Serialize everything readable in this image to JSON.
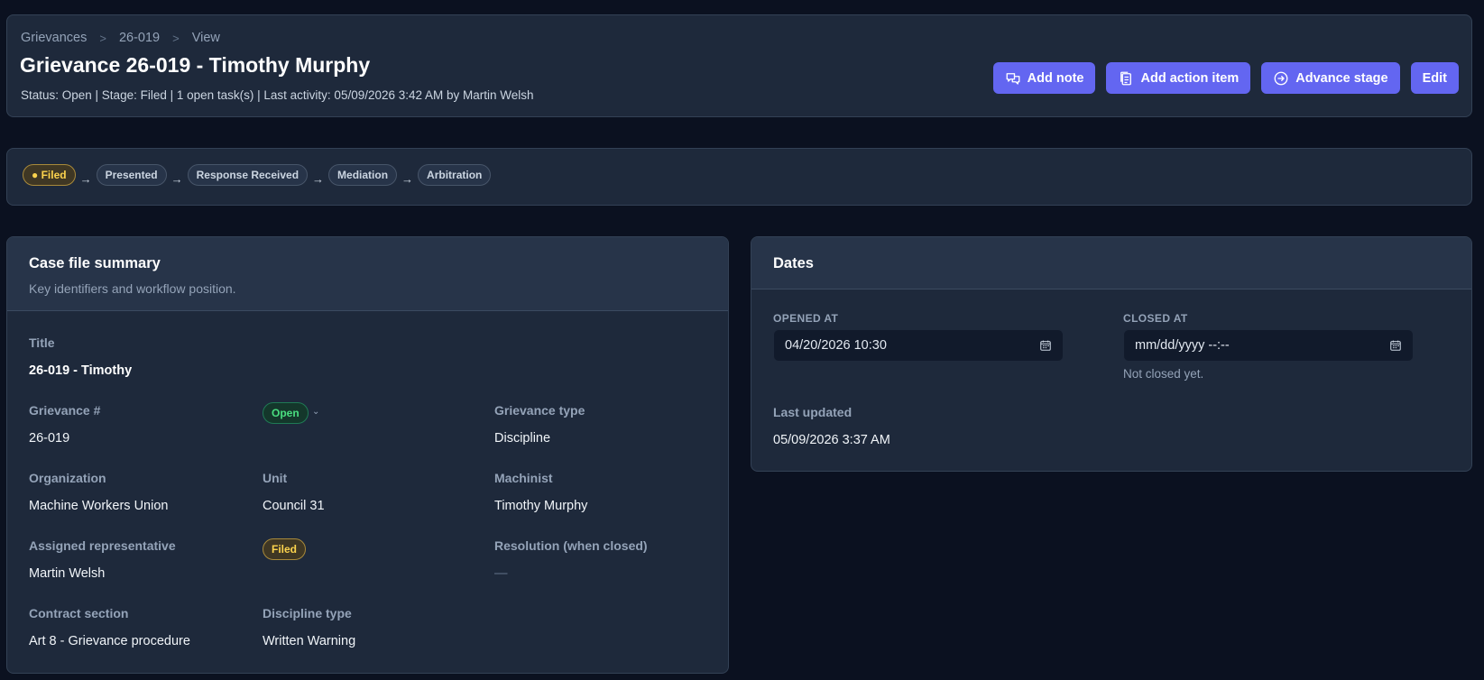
{
  "breadcrumb": {
    "items": [
      "Grievances",
      "26-019",
      "View"
    ]
  },
  "header": {
    "title": "Grievance 26-019 - Timothy Murphy",
    "status_line": "Status: Open | Stage: Filed | 1 open task(s) | Last activity: 05/09/2026 3:42 AM by Martin Welsh"
  },
  "actions": {
    "add_note": "Add note",
    "add_action_item": "Add action item",
    "advance_stage": "Advance stage",
    "edit": "Edit"
  },
  "stages": {
    "items": [
      "Filed",
      "Presented",
      "Response Received",
      "Mediation",
      "Arbitration"
    ],
    "active_marker": "●",
    "arrow": "→"
  },
  "summary": {
    "title": "Case file summary",
    "subtitle": "Key identifiers and workflow position.",
    "title_label": "Title",
    "title_value": "26-019 - Timothy",
    "grievance_no_label": "Grievance #",
    "grievance_no_value": "26-019",
    "status_badge": "Open",
    "grievance_type_label": "Grievance type",
    "grievance_type_value": "Discipline",
    "organization_label": "Organization",
    "organization_value": "Machine Workers Union",
    "unit_label": "Unit",
    "unit_value": "Council 31",
    "machinist_label": "Machinist",
    "machinist_value": "Timothy Murphy",
    "assigned_rep_label": "Assigned representative",
    "assigned_rep_value": "Martin Welsh",
    "stage_badge": "Filed",
    "resolution_label": "Resolution (when closed)",
    "resolution_value": "—",
    "contract_section_label": "Contract section",
    "contract_section_value": "Art 8 - Grievance procedure",
    "discipline_type_label": "Discipline type",
    "discipline_type_value": "Written Warning"
  },
  "dates": {
    "title": "Dates",
    "opened_label": "OPENED AT",
    "opened_value": "04/20/2026 10:30",
    "closed_label": "CLOSED AT",
    "closed_placeholder": "mm/dd/yyyy --:--",
    "closed_hint": "Not closed yet.",
    "last_updated_label": "Last updated",
    "last_updated_value": "05/09/2026 3:37 AM"
  },
  "colors": {
    "background": "#0b1120",
    "panel": "#1e293b",
    "accent": "#6366f1",
    "status_open": "#4ade80",
    "stage_filed": "#fcd34d"
  },
  "icons": {
    "add_note": "chat-bubbles-icon",
    "add_action_item": "clipboard-icon",
    "advance_stage": "arrow-circle-right-icon",
    "date_picker": "calendar-icon"
  }
}
